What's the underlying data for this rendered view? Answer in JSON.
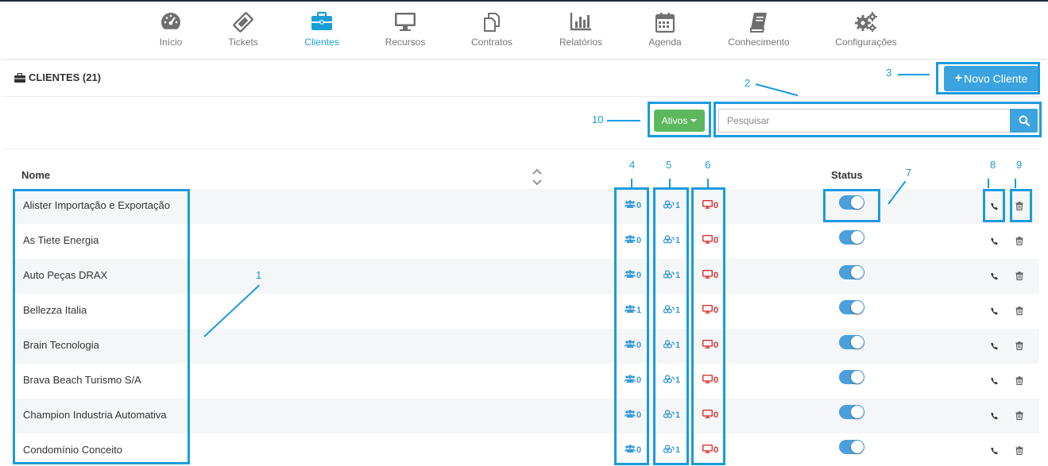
{
  "nav": [
    {
      "label": "Início",
      "icon": "dashboard-gauge-icon",
      "active": false
    },
    {
      "label": "Tickets",
      "icon": "ticket-icon",
      "active": false
    },
    {
      "label": "Clientes",
      "icon": "briefcase-icon",
      "active": true
    },
    {
      "label": "Recursos",
      "icon": "monitor-icon",
      "active": false
    },
    {
      "label": "Contratos",
      "icon": "copy-documents-icon",
      "active": false
    },
    {
      "label": "Relatórios",
      "icon": "bar-chart-icon",
      "active": false
    },
    {
      "label": "Agenda",
      "icon": "calendar-icon",
      "active": false
    },
    {
      "label": "Conhecimento",
      "icon": "book-icon",
      "active": false
    },
    {
      "label": "Configurações",
      "icon": "gears-icon",
      "active": false
    }
  ],
  "header": {
    "title": "CLIENTES (21)",
    "icon": "briefcase-icon"
  },
  "toolbar": {
    "new_client_label": "Novo Cliente",
    "filter_label": "Ativos",
    "search_placeholder": "Pesquisar",
    "search_icon": "search-icon"
  },
  "table": {
    "col_name": "Nome",
    "col_status": "Status",
    "rows": [
      {
        "name": "Alister Importação e Exportação",
        "users": "0",
        "resources": "1",
        "devices": "0",
        "active": true
      },
      {
        "name": "As Tiete Energia",
        "users": "0",
        "resources": "1",
        "devices": "0",
        "active": true
      },
      {
        "name": "Auto Peças DRAX",
        "users": "0",
        "resources": "1",
        "devices": "0",
        "active": true
      },
      {
        "name": "Bellezza Italia",
        "users": "1",
        "resources": "1",
        "devices": "0",
        "active": true
      },
      {
        "name": "Brain Tecnologia",
        "users": "0",
        "resources": "1",
        "devices": "0",
        "active": true
      },
      {
        "name": "Brava Beach Turismo S/A",
        "users": "0",
        "resources": "1",
        "devices": "0",
        "active": true
      },
      {
        "name": "Champion Industria Automativa",
        "users": "0",
        "resources": "1",
        "devices": "0",
        "active": true
      },
      {
        "name": "Condomínio Conceito",
        "users": "0",
        "resources": "1",
        "devices": "0",
        "active": true
      }
    ]
  },
  "annotations": {
    "n1": "1",
    "n2": "2",
    "n3": "3",
    "n4": "4",
    "n5": "5",
    "n6": "6",
    "n7": "7",
    "n8": "8",
    "n9": "9",
    "n10": "10"
  },
  "colors": {
    "accent": "#1a9fd8",
    "primary_button": "#3ba3e0",
    "success_button": "#5cb85c",
    "danger_text": "#d9302c",
    "annotation": "#1a9be0"
  }
}
